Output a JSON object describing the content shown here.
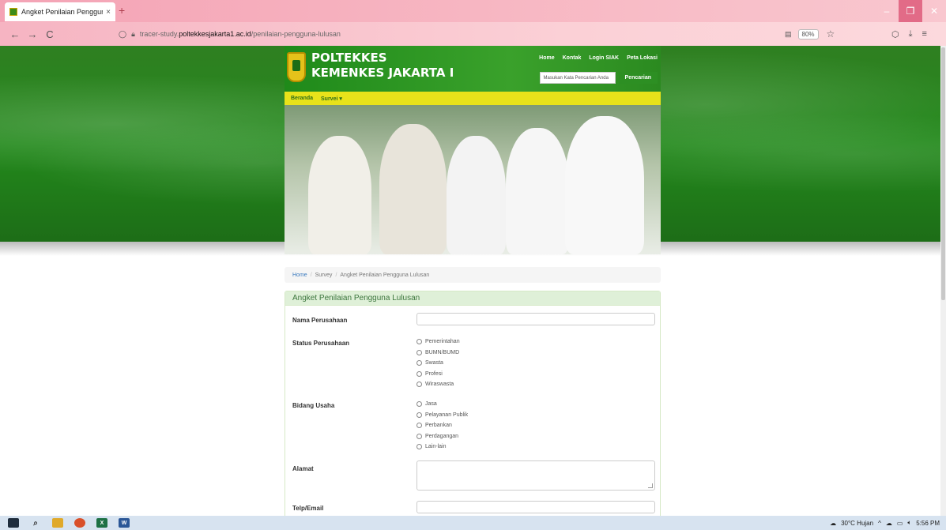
{
  "browser": {
    "tab_title": "Angket Penilaian Pengguna Lul",
    "tab_close": "×",
    "new_tab": "+",
    "back": "←",
    "forward": "→",
    "reload": "C",
    "url_prefix": "tracer-study.",
    "url_domain": "poltekkesjakarta1.ac.id",
    "url_path": "/penilaian-pengguna-lulusan",
    "zoom": "80%",
    "star": "☆",
    "minimize": "–",
    "restore": "❐",
    "close": "✕"
  },
  "site": {
    "name_line1": "POLTEKKES",
    "name_line2": "KEMENKES JAKARTA I",
    "topnav": [
      "Home",
      "Kontak",
      "Login SIAK",
      "Peta Lokasi"
    ],
    "search_placeholder": "Masukan Kata Pencarian Anda",
    "search_button": "Pencarian",
    "menu": [
      "Beranda",
      "Survei ▾"
    ]
  },
  "breadcrumb": {
    "home": "Home",
    "sep": "/",
    "survey": "Survey",
    "current": "Angket Penilaian Pengguna Lulusan"
  },
  "form": {
    "heading": "Angket Penilaian Pengguna Lulusan",
    "nama_label": "Nama Perusahaan",
    "status_label": "Status Perusahaan",
    "status_options": [
      "Pemerintahan",
      "BUMN/BUMD",
      "Swasta",
      "Profesi",
      "Wiraswasta"
    ],
    "bidang_label": "Bidang Usaha",
    "bidang_options": [
      "Jasa",
      "Pelayanan Publik",
      "Perbankan",
      "Perdagangan",
      "Lain-lain"
    ],
    "alamat_label": "Alamat",
    "telp_label": "Telp/Email"
  },
  "taskbar": {
    "weather": "30°C Hujan",
    "time": "5:56 PM"
  }
}
